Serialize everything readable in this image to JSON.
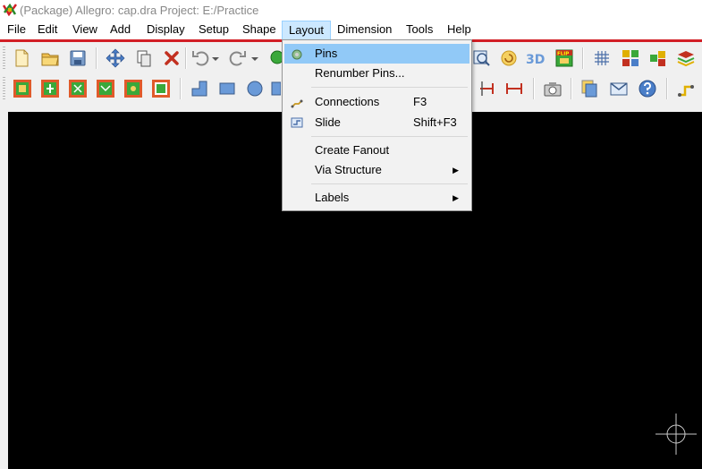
{
  "window": {
    "title": "(Package) Allegro: cap.dra  Project: E:/Practice"
  },
  "menubar": {
    "items": [
      "File",
      "Edit",
      "View",
      "Add",
      "Display",
      "Setup",
      "Shape",
      "Layout",
      "Dimension",
      "Tools",
      "Help"
    ],
    "active": "Layout"
  },
  "layout_menu": {
    "items": [
      {
        "label": "Pins",
        "shortcut": "",
        "icon": "pins-icon",
        "highlighted": true
      },
      {
        "label": "Renumber Pins...",
        "shortcut": ""
      },
      {
        "label": "Connections",
        "shortcut": "F3",
        "icon": "connections-icon"
      },
      {
        "label": "Slide",
        "shortcut": "Shift+F3",
        "icon": "slide-icon"
      },
      {
        "label": "Create Fanout",
        "shortcut": ""
      },
      {
        "label": "Via Structure",
        "shortcut": "",
        "submenu": true
      },
      {
        "label": "Labels",
        "shortcut": "",
        "submenu": true
      }
    ]
  },
  "toolbar_row1": {
    "icons": [
      "new-file-icon",
      "open-folder-icon",
      "save-icon",
      "move-icon",
      "copy-icon",
      "delete-icon",
      "undo-icon",
      "undo-dropdown-icon",
      "redo-icon",
      "redo-dropdown-icon",
      "zoom-icon",
      "zoom-fit-icon",
      "refresh-icon",
      "3d-view-icon",
      "flip-icon",
      "grid-icon",
      "color-icon",
      "layers-icon",
      "stack-icon"
    ],
    "labels": {
      "3d": "3D",
      "flip": "FLIP"
    }
  },
  "toolbar_row2": {
    "icons": [
      "component-1-icon",
      "component-2-icon",
      "component-3-icon",
      "component-4-icon",
      "component-5-icon",
      "component-6-icon",
      "line-shape-icon",
      "rectangle-shape-icon",
      "circle-shape-icon",
      "dimension-1-icon",
      "dimension-2-icon",
      "camera-icon",
      "report-icon",
      "envelope-icon",
      "help-icon",
      "route-icon"
    ]
  },
  "colors": {
    "accent_red": "#d21f26",
    "menu_highlight": "#91c9f7",
    "active_menu": "#cce8ff",
    "canvas": "#000000",
    "crosshair": "#c8c8c8"
  }
}
